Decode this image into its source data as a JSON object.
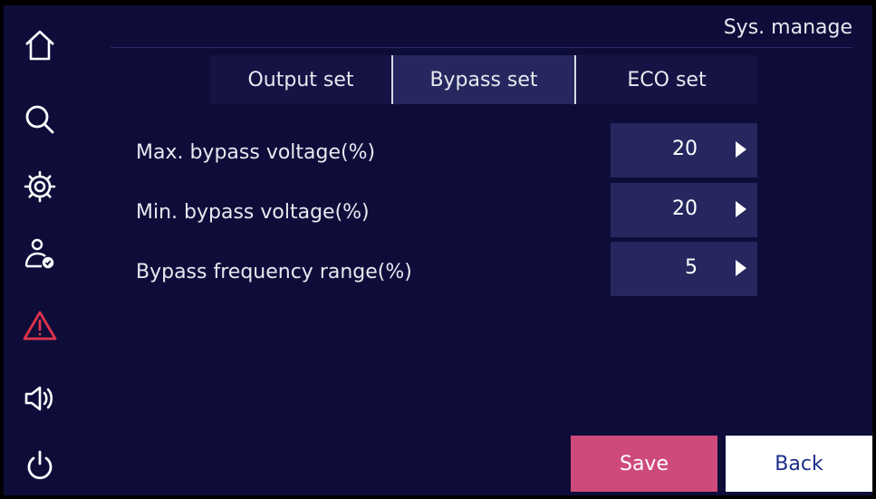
{
  "header": {
    "title": "Sys. manage"
  },
  "sidebar": {
    "items": [
      {
        "icon": "home-icon"
      },
      {
        "icon": "search-icon"
      },
      {
        "icon": "gear-icon"
      },
      {
        "icon": "user-check-icon"
      },
      {
        "icon": "alarm-warning-icon",
        "color": "#e0344b"
      },
      {
        "icon": "speaker-icon"
      },
      {
        "icon": "power-icon"
      }
    ]
  },
  "tabs": [
    {
      "label": "Output set"
    },
    {
      "label": "Bypass set",
      "active": true
    },
    {
      "label": "ECO set"
    }
  ],
  "settings": [
    {
      "label": "Max. bypass voltage(%)",
      "value": "20"
    },
    {
      "label": "Min. bypass voltage(%)",
      "value": "20"
    },
    {
      "label": "Bypass frequency range(%)",
      "value": "5"
    }
  ],
  "buttons": {
    "save": "Save",
    "back": "Back"
  },
  "colors": {
    "background": "#0e0d3a",
    "panel": "#25275e",
    "save": "#cf4a7c",
    "back_text": "#1c2d8a",
    "warning": "#e0344b"
  }
}
